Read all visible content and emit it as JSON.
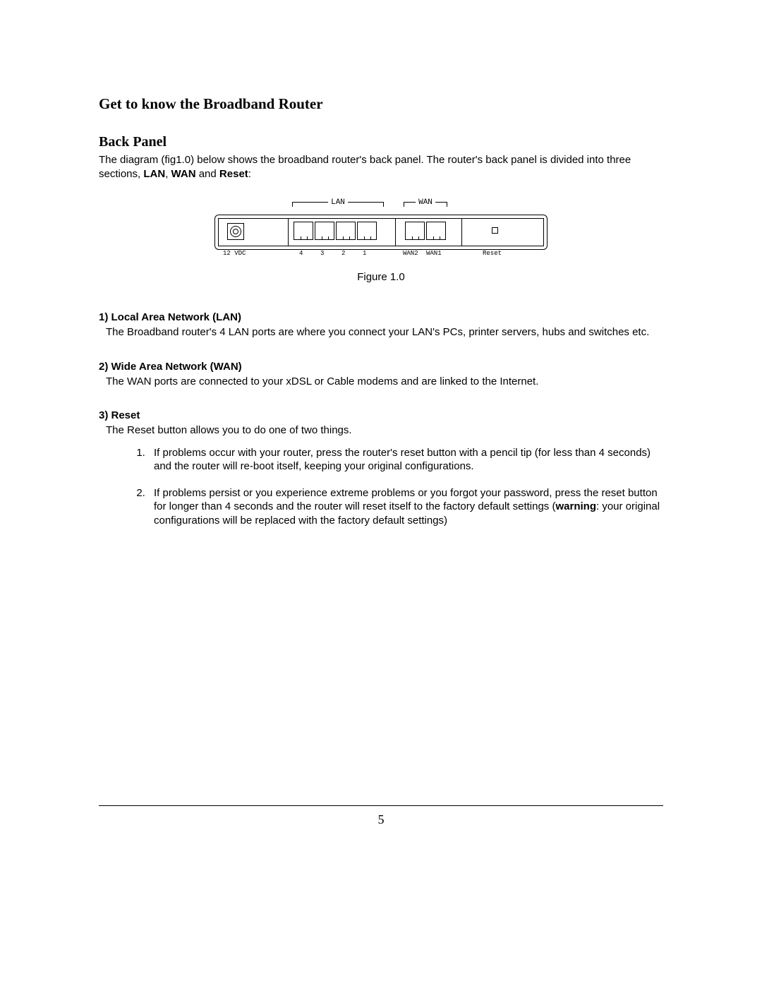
{
  "title": "Get to know the Broadband Router",
  "subtitle": "Back Panel",
  "intro_pre": "The diagram (fig1.0) below shows the broadband router's back panel. The router's back panel is divided into three sections, ",
  "intro_b1": "LAN",
  "intro_sep1": ", ",
  "intro_b2": "WAN",
  "intro_sep2": " and ",
  "intro_b3": "Reset",
  "intro_post": ":",
  "diagram": {
    "lan_label": "LAN",
    "wan_label": "WAN",
    "power_label": "12 VDC",
    "lan_ports": [
      "4",
      "3",
      "2",
      "1"
    ],
    "wan_ports": [
      "WAN2",
      "WAN1"
    ],
    "reset_label": "Reset"
  },
  "figure_caption": "Figure 1.0",
  "sections": {
    "lan": {
      "heading": "1) Local Area Network (LAN)",
      "body": "The Broadband router's 4 LAN ports are where you connect your LAN's PCs, printer servers, hubs and switches etc."
    },
    "wan": {
      "heading": "2) Wide Area Network (WAN)",
      "body": "The WAN ports are connected to your xDSL or Cable modems and are linked to the Internet."
    },
    "reset": {
      "heading": "3) Reset",
      "body": "The Reset button allows you to do one of two things.",
      "items": [
        "If problems occur with your router, press the router's reset button with a pencil tip (for less than 4 seconds) and the router will re-boot itself, keeping your original configurations.",
        {
          "pre": "If problems persist or you experience extreme problems or you forgot your password, press the reset button for longer than 4 seconds and the router will reset itself to the factory default settings (",
          "bold": "warning",
          "post": ": your original configurations will be replaced with the factory default settings)"
        }
      ]
    }
  },
  "page_number": "5"
}
